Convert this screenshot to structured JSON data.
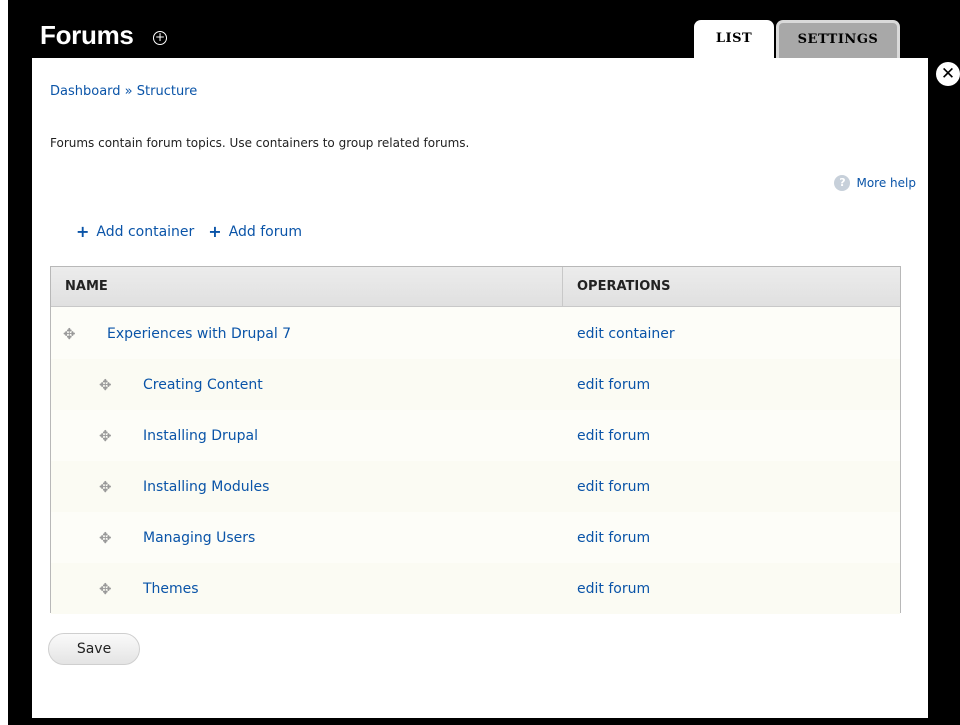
{
  "header": {
    "title": "Forums",
    "add_icon": "plus-circle-icon",
    "tabs": [
      {
        "label": "LIST",
        "active": true
      },
      {
        "label": "SETTINGS",
        "active": false
      }
    ],
    "close_icon": "close-circle-icon"
  },
  "breadcrumb": {
    "items": [
      "Dashboard",
      "Structure"
    ],
    "separator": "»"
  },
  "intro_text": "Forums contain forum topics. Use containers to group related forums.",
  "more_help": {
    "label": "More help",
    "icon": "help-icon"
  },
  "actions": [
    {
      "label": "Add container",
      "icon": "plus-icon"
    },
    {
      "label": "Add forum",
      "icon": "plus-icon"
    }
  ],
  "table": {
    "columns": [
      "NAME",
      "OPERATIONS"
    ],
    "rows": [
      {
        "name": "Experiences with Drupal 7",
        "operation": "edit container",
        "level": 0
      },
      {
        "name": "Creating Content",
        "operation": "edit forum",
        "level": 1
      },
      {
        "name": "Installing Drupal",
        "operation": "edit forum",
        "level": 1
      },
      {
        "name": "Installing Modules",
        "operation": "edit forum",
        "level": 1
      },
      {
        "name": "Managing Users",
        "operation": "edit forum",
        "level": 1
      },
      {
        "name": "Themes",
        "operation": "edit forum",
        "level": 1
      }
    ]
  },
  "save_label": "Save",
  "colors": {
    "link": "#0a54a8",
    "frame": "#000000",
    "tab_inactive": "#a8a8a8"
  }
}
